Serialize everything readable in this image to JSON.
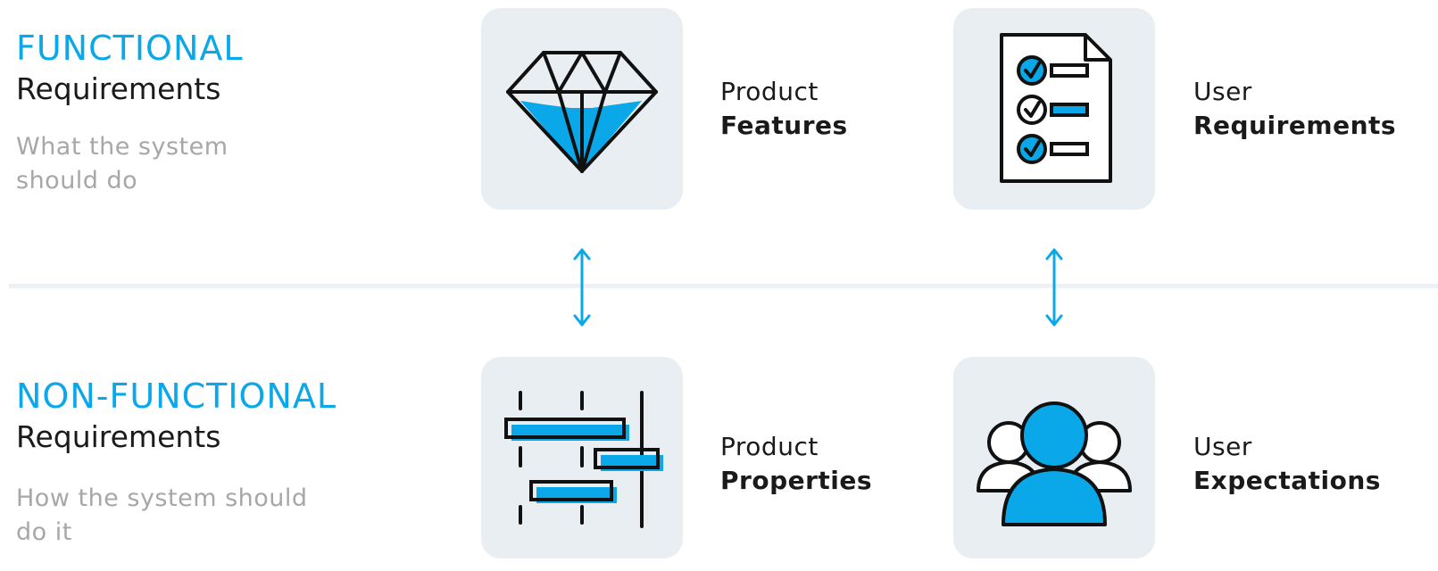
{
  "functional": {
    "title": "FUNCTIONAL",
    "subtitle": "Requirements",
    "description": "What the system should do"
  },
  "non_functional": {
    "title": "NON-FUNCTIONAL",
    "subtitle": "Requirements",
    "description": "How the system should do it"
  },
  "items": {
    "product_features": {
      "line1": "Product",
      "line2": "Features",
      "icon": "diamond-icon"
    },
    "user_requirements": {
      "line1": "User",
      "line2": "Requirements",
      "icon": "checklist-document-icon"
    },
    "product_properties": {
      "line1": "Product",
      "line2": "Properties",
      "icon": "gantt-chart-icon"
    },
    "user_expectations": {
      "line1": "User",
      "line2": "Expectations",
      "icon": "user-group-icon"
    }
  },
  "colors": {
    "accent": "#0aa8e8",
    "tile_background": "#e9eef3",
    "outline": "#111111",
    "description_text": "#a7a7a7"
  }
}
